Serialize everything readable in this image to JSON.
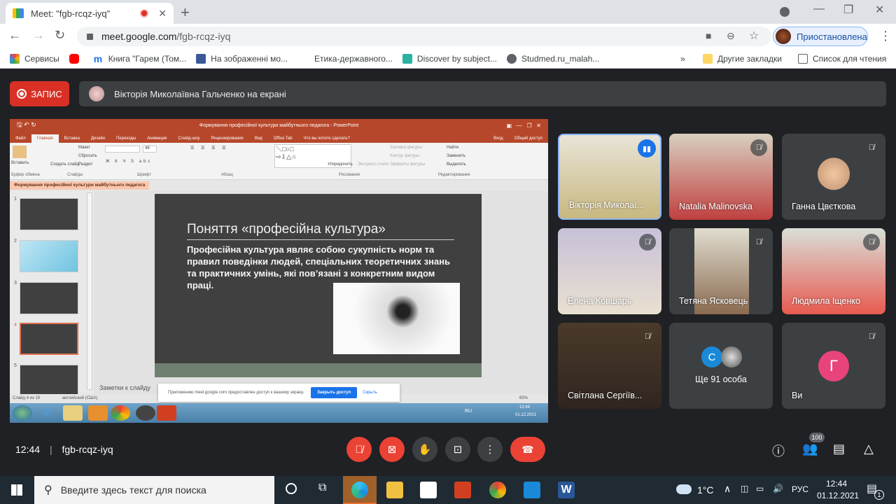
{
  "browser": {
    "tab_title": "Meet: \"fgb-rcqz-iyq\"",
    "new_tab": "+",
    "url_host": "meet.google.com",
    "url_path": "/fgb-rcqz-iyq",
    "profile_label": "Приостановлена",
    "bookmarks": [
      {
        "label": "Сервисы",
        "icon": "apps-grid-icon"
      },
      {
        "label": "",
        "icon": "youtube-icon"
      },
      {
        "label": "Книга \"Гарем (Том...",
        "icon": "m-logo-icon"
      },
      {
        "label": "На зображенні мо...",
        "icon": "facebook-icon"
      },
      {
        "label": "Етика-державного...",
        "icon": ""
      },
      {
        "label": "Discover by subject...",
        "icon": "r-logo-icon"
      },
      {
        "label": "Studmed.ru_malah...",
        "icon": "globe-icon"
      }
    ],
    "bookmarks_overflow": "»",
    "other_bookmarks": "Другие закладки",
    "reading_list": "Список для чтения"
  },
  "meet": {
    "record_label": "ЗАПИС",
    "presenting_text": "Вікторія Миколаївна Гальченко на екрані",
    "clock": "12:44",
    "meeting_code": "fgb-rcqz-iyq",
    "participants_count": "100",
    "tiles": [
      {
        "name": "Вікторія Миколаї...",
        "state": "speaking"
      },
      {
        "name": "Natalia Malinovska",
        "state": "muted"
      },
      {
        "name": "Ганна Цвєткова",
        "state": "muted"
      },
      {
        "name": "Елена Ковшарь",
        "state": "muted"
      },
      {
        "name": "Тетяна Ясковець",
        "state": "muted"
      },
      {
        "name": "Людмила Іщенко",
        "state": "muted"
      },
      {
        "name": "Світлана Сергіїв...",
        "state": "muted"
      },
      {
        "name": "Ще 91 особа",
        "avatar_letter": "С"
      },
      {
        "name": "Ви",
        "avatar_letter": "Г",
        "state": "muted"
      }
    ],
    "colors": {
      "accent": "#1a73e8",
      "danger": "#ea4335",
      "you_avatar": "#e8437a",
      "other_avatar": "#1a8ad8"
    }
  },
  "powerpoint": {
    "window_title": "Формування професійної культури майбутнього педагога - PowerPoint",
    "tabs": [
      "Файл",
      "Главная",
      "Вставка",
      "Дизайн",
      "Переходы",
      "Анимация",
      "Слайд-шоу",
      "Рецензирование",
      "Вид",
      "Office Tab"
    ],
    "tell_me": "Что вы хотите сделать?",
    "sign_in": "Вход",
    "share": "Общий доступ",
    "ribbon": {
      "paste": "Вставить",
      "new_slide": "Создать слайд",
      "layout": "Макет",
      "reset": "Сбросить",
      "section": "Раздел",
      "font_size": "48",
      "arrange": "Упорядочить",
      "quick_styles": "Экспресс-стили",
      "fill": "Заливка фигуры",
      "outline": "Контур фигуры",
      "effects": "Эффекты фигуры",
      "find": "Найти",
      "replace": "Заменить",
      "select": "Выделить",
      "groups": [
        "Буфер обмена",
        "Слайды",
        "Шрифт",
        "Абзац",
        "Рисование",
        "Редактирование"
      ]
    },
    "doc_tab": "Формування професійної культури майбутнього педагога",
    "slide_numbers": [
      "1",
      "2",
      "3",
      "4",
      "5"
    ],
    "slide": {
      "title": "Поняття «професійна культура»",
      "body": "Професійна культура являє собою сукупність норм та правил поведінки людей, спеціальних теоретичних знань та практичних умінь, які пов’язані з конкретним видом праці."
    },
    "notes": "Заметки к слайду",
    "status": "Слайд 4 из 19",
    "language": "английский (США)",
    "zoom": "65%",
    "share_notice": "Приложению meet.google.com предоставлен доступ к вашему экрану.",
    "stop_sharing": "Закрыть доступ",
    "hide": "Скрыть",
    "win7_lang": "RU",
    "win7_time": "12:44",
    "win7_date": "01.12.2021"
  },
  "taskbar": {
    "search_placeholder": "Введите здесь текст для поиска",
    "weather": "1°C",
    "lang": "РУС",
    "time": "12:44",
    "date": "01.12.2021",
    "notif_count": "1"
  }
}
